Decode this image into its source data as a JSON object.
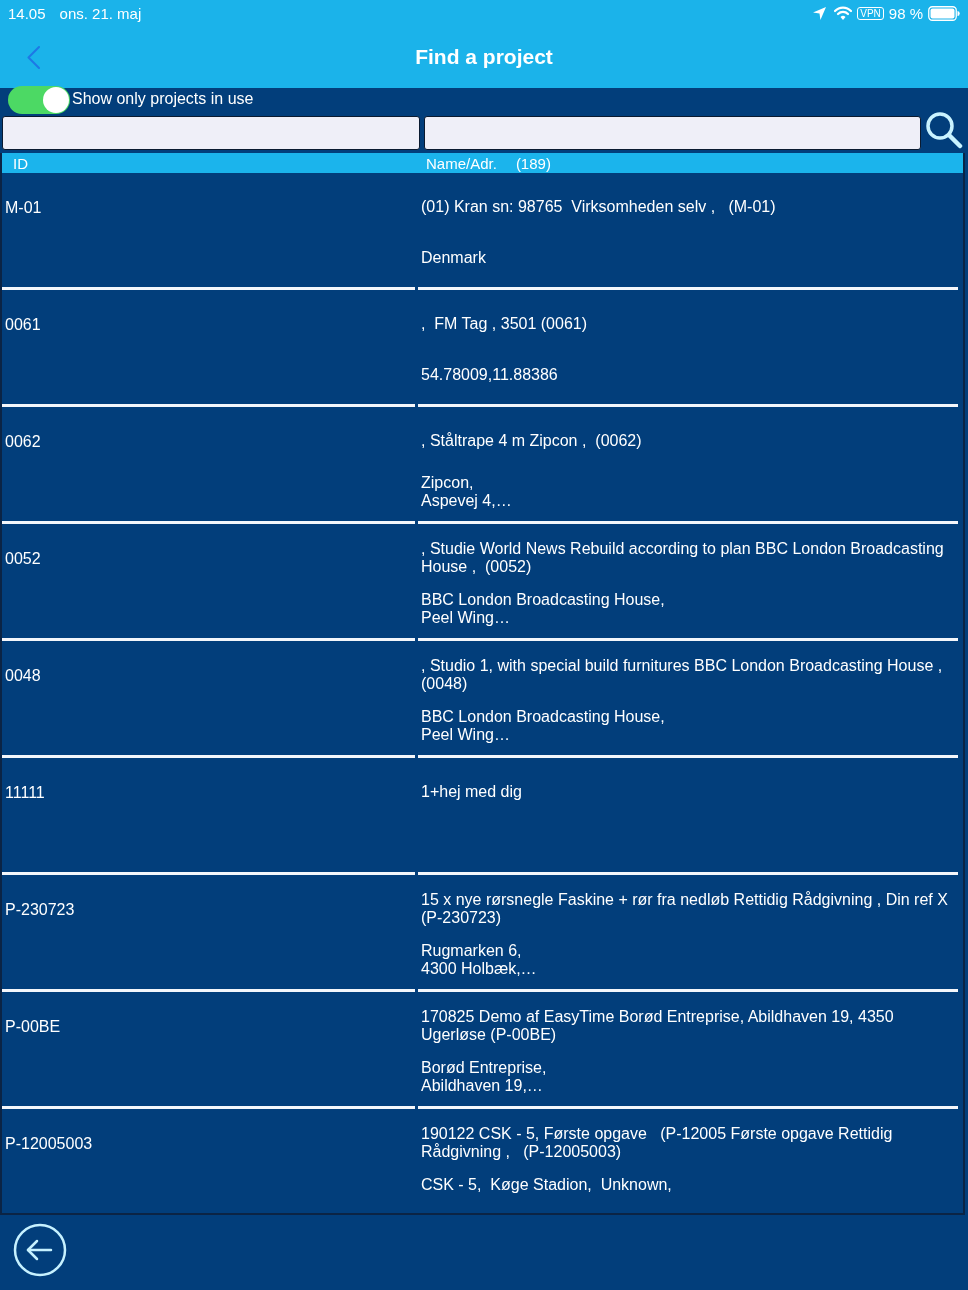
{
  "status_bar": {
    "time": "14.05",
    "date": "ons. 21. maj",
    "vpn": "VPN",
    "battery": "98 %"
  },
  "nav_bar": {
    "title": "Find a project"
  },
  "filter": {
    "label": "Show only projects in use",
    "on": true
  },
  "table": {
    "columns": [
      {
        "label": "ID"
      },
      {
        "label": "Name/Adr.",
        "count": "(189)"
      }
    ],
    "rows": [
      {
        "id": "M-01",
        "name": "(01) Kran sn: 98765  Virksomheden selv ,   (M-01)",
        "address": "Denmark"
      },
      {
        "id": "0061",
        "name": ",  FM Tag , 3501 (0061)",
        "address": "54.78009,11.88386"
      },
      {
        "id": "0062",
        "name": ", Ståltrape 4 m Zipcon ,  (0062)",
        "address": "Zipcon,\nAspevej 4,…"
      },
      {
        "id": "0052",
        "name": ", Studie World News Rebuild according to plan BBC London Broadcasting House ,  (0052)",
        "address": "BBC London Broadcasting House,\nPeel Wing…"
      },
      {
        "id": "0048",
        "name": ", Studio 1, with special build furnitures BBC London Broadcasting House , (0048)",
        "address": "BBC London Broadcasting House,\nPeel Wing…"
      },
      {
        "id": "11111",
        "name": "1+hej med dig"
      },
      {
        "id": "P-230723",
        "name": "15 x nye rørsnegle Faskine + rør fra nedløb Rettidig Rådgivning , Din ref X (P-230723)",
        "address": "Rugmarken 6,\n4300 Holbæk,…"
      },
      {
        "id": "P-00BE",
        "name": "170825 Demo af EasyTime Borød Entreprise, Abildhaven 19, 4350 Ugerløse (P-00BE)",
        "address": "Borød Entreprise,\nAbildhaven 19,…"
      },
      {
        "id": "P-12005003",
        "name": "190122 CSK - 5, Første opgave   (P-12005 Første opgave Rettidig Rådgivning ,   (P-12005003)",
        "address": "CSK - 5,  Køge Stadion,  Unknown,"
      }
    ]
  }
}
